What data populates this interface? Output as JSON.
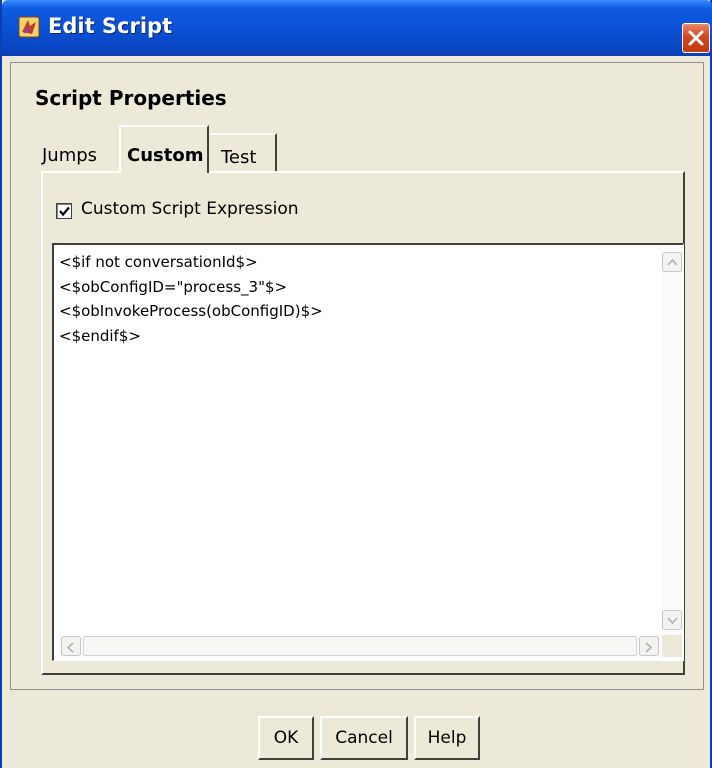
{
  "window": {
    "title": "Edit Script",
    "icon": "app-icon",
    "close_icon": "close-icon"
  },
  "section": {
    "title": "Script Properties"
  },
  "tabs": [
    {
      "label": "Jumps",
      "selected": false
    },
    {
      "label": "Custom",
      "selected": true
    },
    {
      "label": "Test",
      "selected": false
    }
  ],
  "custom": {
    "checkbox_label": "Custom Script Expression",
    "checkbox_checked": true,
    "script_lines": [
      "<$if not conversationId$>",
      "<$obConfigID=\"process_3\"$>",
      "<$obInvokeProcess(obConfigID)$>",
      "<$endif$>"
    ]
  },
  "buttons": {
    "ok": "OK",
    "cancel": "Cancel",
    "help": "Help"
  },
  "colors": {
    "titlebar": "#0a4fd3",
    "dialog_bg": "#ece9d8",
    "close_button": "#d6451b"
  }
}
